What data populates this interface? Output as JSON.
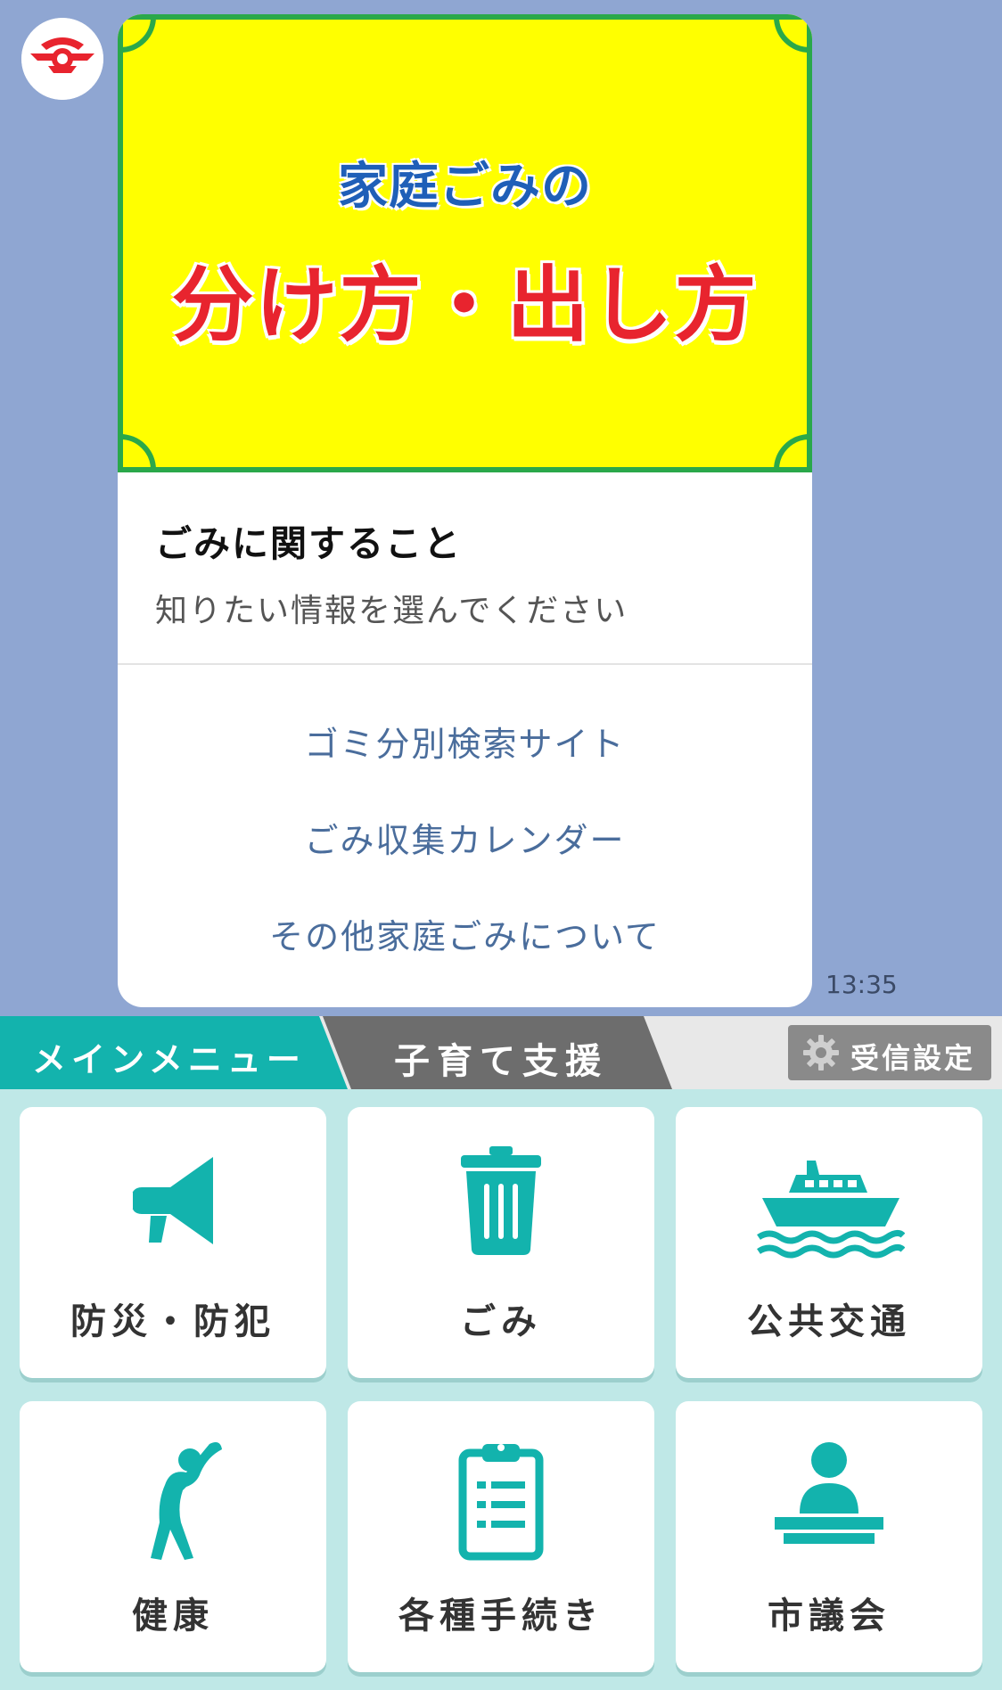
{
  "colors": {
    "chat_background": "#8fa6d2",
    "banner_yellow": "#ffff00",
    "banner_green_frame": "#2aa84a",
    "banner_blue_text": "#1f5fb8",
    "banner_red_text": "#e8242e",
    "action_link": "#4a6d9c",
    "menu_teal": "#13b3ad",
    "menu_background": "#bfe8e7",
    "tab_gray": "#6d6d6d"
  },
  "chat": {
    "avatar_icon": "city-emblem-icon",
    "message": {
      "banner": {
        "line1": "家庭ごみの",
        "line2": "分け方・出し方"
      },
      "title": "ごみに関すること",
      "subtitle": "知りたい情報を選んでください",
      "actions": [
        {
          "label": "ゴミ分別検索サイト"
        },
        {
          "label": "ごみ収集カレンダー"
        },
        {
          "label": "その他家庭ごみについて"
        }
      ],
      "timestamp": "13:35"
    }
  },
  "menu": {
    "tabs": [
      {
        "label": "メインメニュー",
        "active": true
      },
      {
        "label": "子育て支援",
        "active": false
      }
    ],
    "settings": {
      "label": "受信設定",
      "icon": "gear-icon"
    },
    "tiles": [
      {
        "label": "防災・防犯",
        "icon": "megaphone-icon"
      },
      {
        "label": "ごみ",
        "icon": "trash-can-icon"
      },
      {
        "label": "公共交通",
        "icon": "ferry-boat-icon"
      },
      {
        "label": "健康",
        "icon": "stretching-person-icon"
      },
      {
        "label": "各種手続き",
        "icon": "clipboard-checklist-icon"
      },
      {
        "label": "市議会",
        "icon": "speaker-podium-icon"
      }
    ]
  }
}
